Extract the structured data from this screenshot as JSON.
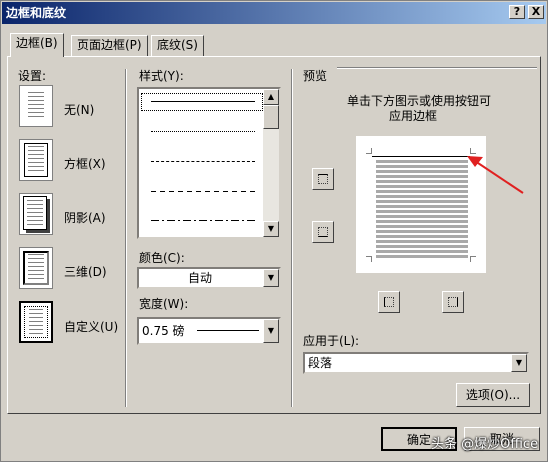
{
  "window": {
    "title": "边框和底纹",
    "help_btn": "?",
    "close_btn": "X"
  },
  "tabs": [
    {
      "label": "边框(B)"
    },
    {
      "label": "页面边框(P)"
    },
    {
      "label": "底纹(S)"
    }
  ],
  "settings": {
    "heading": "设置:",
    "items": [
      {
        "label": "无(N)",
        "icon": "no-border-icon"
      },
      {
        "label": "方框(X)",
        "icon": "box-border-icon"
      },
      {
        "label": "阴影(A)",
        "icon": "shadow-border-icon"
      },
      {
        "label": "三维(D)",
        "icon": "3d-border-icon"
      },
      {
        "label": "自定义(U)",
        "icon": "custom-border-icon"
      }
    ]
  },
  "style": {
    "heading": "样式(Y):",
    "line_styles": [
      "solid",
      "dotted",
      "dashed-small",
      "dashed",
      "dash-dot"
    ]
  },
  "color": {
    "label": "颜色(C):",
    "value": "自动"
  },
  "width": {
    "label": "宽度(W):",
    "value": "0.75 磅"
  },
  "preview": {
    "heading": "预览",
    "hint_line1": "单击下方图示或使用按钮可",
    "hint_line2": "应用边框"
  },
  "apply_to": {
    "label": "应用于(L):",
    "value": "段落"
  },
  "buttons": {
    "options": "选项(O)...",
    "ok": "确定",
    "cancel": "取消"
  },
  "watermark": "头条 @爆炒Office",
  "colors": {
    "title_start": "#0a246a",
    "title_end": "#a6caf0",
    "face": "#d4d0c8",
    "annotation_arrow": "#e02020"
  }
}
